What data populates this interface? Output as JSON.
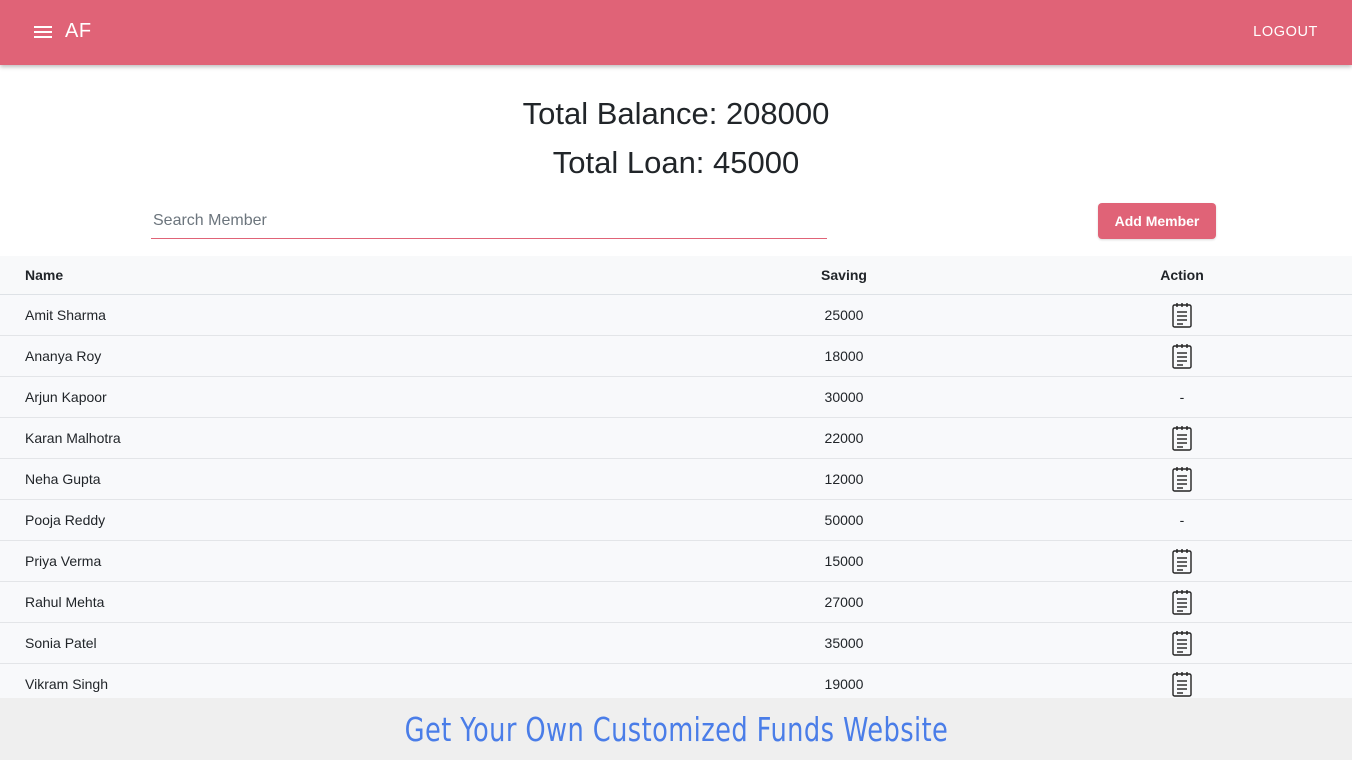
{
  "appbar": {
    "brand": "AF",
    "menu_icon": "hamburger-menu-icon",
    "logout_label": "LOGOUT",
    "color": "#e06377"
  },
  "summary": {
    "total_balance": "Total Balance: 208000",
    "total_loan": "Total Loan: 45000"
  },
  "search": {
    "placeholder": "Search Member",
    "value": ""
  },
  "add_member_label": "Add Member",
  "table": {
    "columns": [
      "Name",
      "Saving",
      "Action"
    ],
    "rows": [
      {
        "name": "Amit Sharma",
        "saving": "25000",
        "action": "clipboard-icon"
      },
      {
        "name": "Ananya Roy",
        "saving": "18000",
        "action": "clipboard-icon"
      },
      {
        "name": "Arjun Kapoor",
        "saving": "30000",
        "action": "-"
      },
      {
        "name": "Karan Malhotra",
        "saving": "22000",
        "action": "clipboard-icon"
      },
      {
        "name": "Neha Gupta",
        "saving": "12000",
        "action": "clipboard-icon"
      },
      {
        "name": "Pooja Reddy",
        "saving": "50000",
        "action": "-"
      },
      {
        "name": "Priya Verma",
        "saving": "15000",
        "action": "clipboard-icon"
      },
      {
        "name": "Rahul Mehta",
        "saving": "27000",
        "action": "clipboard-icon"
      },
      {
        "name": "Sonia Patel",
        "saving": "35000",
        "action": "clipboard-icon"
      },
      {
        "name": "Vikram Singh",
        "saving": "19000",
        "action": "clipboard-icon"
      }
    ]
  },
  "banner": {
    "text": "Get Your Own Customized Funds Website",
    "color": "#4a7de8"
  }
}
